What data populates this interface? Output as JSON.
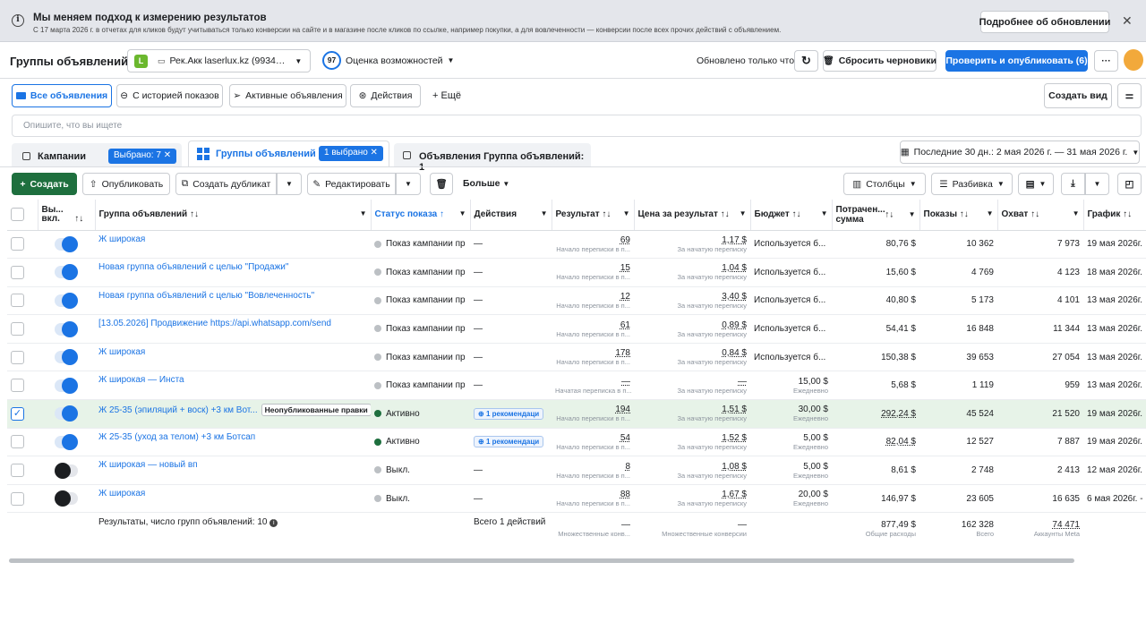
{
  "banner": {
    "title": "Мы меняем подход к измерению результатов",
    "text": "С 17 марта 2026 г. в отчетах для кликов будут учитываться только конверсии на сайте и в магазине после кликов по ссылке, например покупки, а для вовлеченности — конверсии после всех прочих действий с объявлением.",
    "details_button": "Подробнее об обновлении",
    "close": "✕"
  },
  "header": {
    "title": "Группы объявлений",
    "account_letter": "L",
    "account_name": "Рек.Акк laserlux.kz (9934…",
    "score": "97",
    "score_label": "Оценка возможностей",
    "updated": "Обновлено только что",
    "discard_drafts": "Сбросить черновики",
    "publish": "Проверить и опубликовать (6)",
    "more": "···"
  },
  "view_tabs": [
    {
      "label": "Все объявления"
    },
    {
      "label": "С историей показов"
    },
    {
      "label": "Активные объявления"
    },
    {
      "label": "Действия"
    },
    {
      "label": "Ещё"
    }
  ],
  "create_view": "Создать вид",
  "search": {
    "placeholder": "Опишите, что вы ищете"
  },
  "level_tabs": {
    "campaigns": "Кампании",
    "campaigns_selected": "Выбрано: 7",
    "adsets": "Группы объявлений",
    "adsets_selected": "1 выбрано",
    "ads": "Объявления Группа объявлений: 1"
  },
  "date_range": "Последние 30 дн.: 2 мая 2026 г. — 31 мая 2026 г.",
  "toolbar": {
    "create": "Создать",
    "publish": "Опубликовать",
    "duplicate": "Создать дубликат",
    "edit": "Редактировать",
    "more": "Больше",
    "columns": "Столбцы",
    "breakdown": "Разбивка"
  },
  "columns": [
    "Вы... вкл.",
    "Группа объявлений",
    "Статус показа",
    "Действия",
    "Результат",
    "Цена за результат",
    "Бюджет",
    "Потрачен... сумма",
    "Показы",
    "Охват",
    "График"
  ],
  "rows": [
    {
      "name": "Ж широкая",
      "status": "Показ кампании пр",
      "actions": "—",
      "result": "69",
      "result_sub": "Начало переписки в п...",
      "cpr": "1,17 $",
      "cpr_sub": "За начатую переписку",
      "budget": "Используется б...",
      "budget_sub": "",
      "spent": "80,76 $",
      "impr": "10 362",
      "reach": "7 973",
      "sched": "19 мая 2026г.",
      "on": true
    },
    {
      "name": "Новая группа объявлений с целью \"Продажи\"",
      "status": "Показ кампании пр",
      "actions": "—",
      "result": "15",
      "result_sub": "Начало переписки в п...",
      "cpr": "1,04 $",
      "cpr_sub": "За начатую переписку",
      "budget": "Используется б...",
      "budget_sub": "",
      "spent": "15,60 $",
      "impr": "4 769",
      "reach": "4 123",
      "sched": "18 мая 2026г.",
      "on": true
    },
    {
      "name": "Новая группа объявлений с целью \"Вовлеченность\"",
      "status": "Показ кампании пр",
      "actions": "—",
      "result": "12",
      "result_sub": "Начало переписки в п...",
      "cpr": "3,40 $",
      "cpr_sub": "За начатую переписку",
      "budget": "Используется б...",
      "budget_sub": "",
      "spent": "40,80 $",
      "impr": "5 173",
      "reach": "4 101",
      "sched": "13 мая 2026г.",
      "on": true
    },
    {
      "name": "[13.05.2026] Продвижение https://api.whatsapp.com/send",
      "status": "Показ кампании пр",
      "actions": "—",
      "result": "61",
      "result_sub": "Начало переписки в п...",
      "cpr": "0,89 $",
      "cpr_sub": "За начатую переписку",
      "budget": "Используется б...",
      "budget_sub": "",
      "spent": "54,41 $",
      "impr": "16 848",
      "reach": "11 344",
      "sched": "13 мая 2026г.",
      "on": true
    },
    {
      "name": "Ж широкая",
      "status": "Показ кампании пр",
      "actions": "—",
      "result": "178",
      "result_sub": "Начало переписки в п...",
      "cpr": "0,84 $",
      "cpr_sub": "За начатую переписку",
      "budget": "Используется б...",
      "budget_sub": "",
      "spent": "150,38 $",
      "impr": "39 653",
      "reach": "27 054",
      "sched": "13 мая 2026г.",
      "on": true
    },
    {
      "name": "Ж широкая — Инста",
      "status": "Показ кампании пр",
      "actions": "—",
      "result": "—",
      "result_sub": "Начатая переписка в п...",
      "cpr": "—",
      "cpr_sub": "За начатую переписку",
      "budget": "15,00 $",
      "budget_sub": "Ежедневно",
      "spent": "5,68 $",
      "impr": "1 119",
      "reach": "959",
      "sched": "13 мая 2026г.",
      "on": true
    },
    {
      "name": "Ж 25-35 (эпиляций + воск) +3 км Вот...",
      "badge": "Неопубликованные правки",
      "status": "Активно",
      "active": true,
      "actions": "1 рекомендаци",
      "result": "194",
      "result_sub": "Начало переписки в п...",
      "cpr": "1,51 $",
      "cpr_sub": "За начатую переписку",
      "budget": "30,00 $",
      "budget_sub": "Ежедневно",
      "spent": "292,24 $",
      "impr": "45 524",
      "reach": "21 520",
      "sched": "19 мая 2026г.",
      "on": true,
      "selected": true
    },
    {
      "name": "Ж 25-35 (уход за телом) +3 км Ботсап",
      "status": "Активно",
      "active": true,
      "actions": "1 рекомендаци",
      "result": "54",
      "result_sub": "Начало переписки в п...",
      "cpr": "1,52 $",
      "cpr_sub": "За начатую переписку",
      "budget": "5,00 $",
      "budget_sub": "Ежедневно",
      "spent": "82,04 $",
      "impr": "12 527",
      "reach": "7 887",
      "sched": "19 мая 2026г.",
      "on": true
    },
    {
      "name": "Ж широкая — новый вп",
      "status": "Выкл.",
      "actions": "—",
      "result": "8",
      "result_sub": "Начало переписки в п...",
      "cpr": "1,08 $",
      "cpr_sub": "За начатую переписку",
      "budget": "5,00 $",
      "budget_sub": "Ежедневно",
      "spent": "8,61 $",
      "impr": "2 748",
      "reach": "2 413",
      "sched": "12 мая 2026г.",
      "on": false
    },
    {
      "name": "Ж широкая",
      "status": "Выкл.",
      "actions": "—",
      "result": "88",
      "result_sub": "Начало переписки в п...",
      "cpr": "1,67 $",
      "cpr_sub": "За начатую переписку",
      "budget": "20,00 $",
      "budget_sub": "Ежедневно",
      "spent": "146,97 $",
      "impr": "23 605",
      "reach": "16 635",
      "sched": "6 мая 2026г. -",
      "on": false
    }
  ],
  "totals": {
    "label": "Результаты, число групп объявлений: 10",
    "actions": "Всего 1 действий",
    "result": "—",
    "result_sub": "Множественные конв...",
    "cpr": "—",
    "cpr_sub": "Множественные конверсии",
    "spent": "877,49 $",
    "spent_sub": "Общие расходы",
    "impr": "162 328",
    "impr_sub": "Всего",
    "reach": "74 471",
    "reach_sub": "Аккаунты Meta"
  },
  "colors": {
    "accent": "#1b74e4",
    "green": "#1e6f3e",
    "selected_row": "#e7f3e8"
  }
}
